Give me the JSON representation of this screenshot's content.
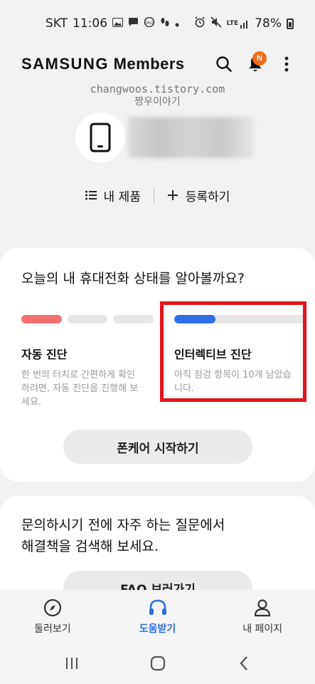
{
  "status_bar": {
    "carrier": "SKT",
    "time": "11:06",
    "network": "LTE",
    "battery": "78%"
  },
  "header": {
    "brand": "SAMSUNG",
    "title": "Members",
    "notification_badge": "N"
  },
  "watermark": {
    "line1": "changwoos.tistory.com",
    "line2": "짱우이야기"
  },
  "product_row": {
    "my_products": "내 제품",
    "register": "등록하기"
  },
  "diagnostics_card": {
    "title": "오늘의 내 휴대전화 상태를 알아볼까요?",
    "auto": {
      "title": "자동 진단",
      "description": "한 번의 터치로 간편하게 확인하려면, 자동 진단을 진행해 보세요.",
      "segments_done": 1,
      "segments_total": 3
    },
    "interactive": {
      "title": "인터렉티브 진단",
      "description": "아직 점검 항목이 10개 남았습니다.",
      "progress": 0.31
    },
    "button": "폰케어 시작하기"
  },
  "faq_card": {
    "title_line1": "문의하시기 전에 자주 하는 질문에서",
    "title_line2": "해결책을 검색해 보세요.",
    "button": "FAQ 보러가기"
  },
  "bottom_nav": {
    "items": [
      {
        "label": "둘러보기",
        "icon": "compass-icon"
      },
      {
        "label": "도움받기",
        "icon": "headset-icon",
        "active": true
      },
      {
        "label": "내 페이지",
        "icon": "person-icon"
      }
    ]
  },
  "colors": {
    "accent": "#2b6ee0",
    "progress": "#2e6fe8",
    "auto_segment": "#f07272",
    "badge": "#f36b1c",
    "highlight": "#e3141c"
  }
}
